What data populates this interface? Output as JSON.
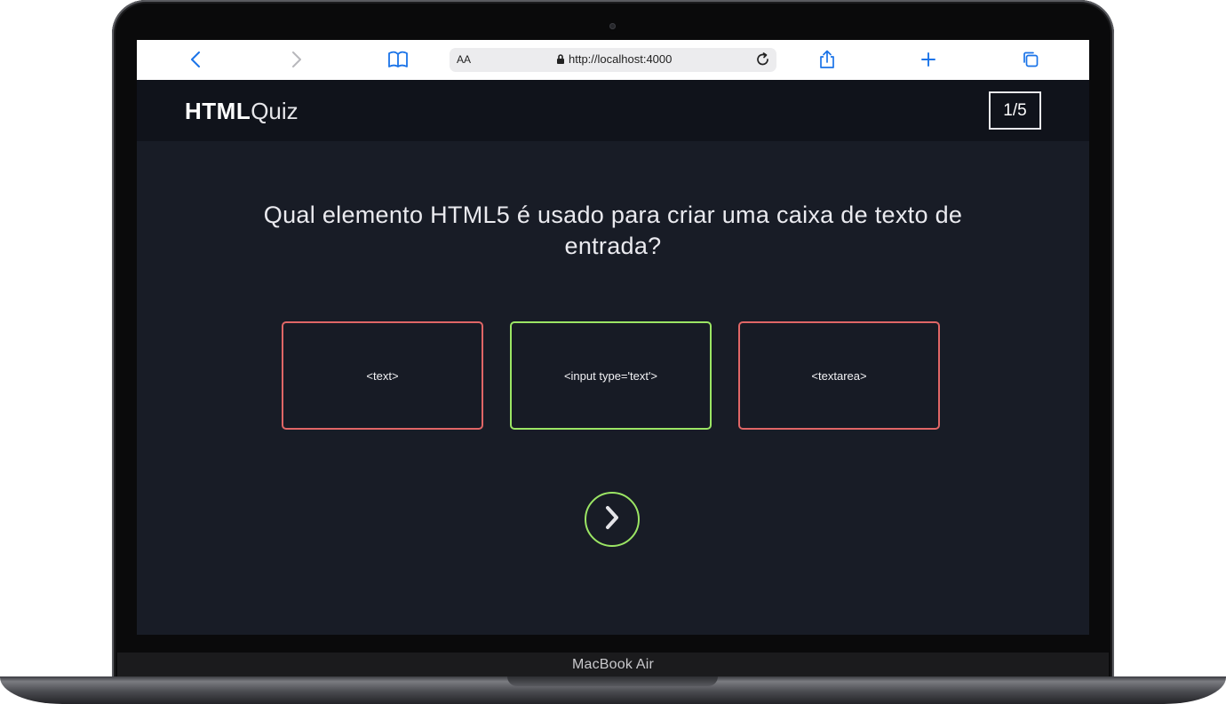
{
  "device": {
    "label": "MacBook Air"
  },
  "browser": {
    "text_size_label": "AA",
    "url": "http://localhost:4000",
    "icons": [
      "back-icon",
      "forward-icon",
      "bookmarks-icon",
      "lock-icon",
      "reload-icon",
      "share-icon",
      "new-tab-icon",
      "tabs-icon"
    ]
  },
  "app": {
    "logo_bold": "HTML",
    "logo_light": "Quiz",
    "progress": "1/5"
  },
  "quiz": {
    "question": "Qual elemento HTML5 é usado para criar uma caixa de texto de entrada?",
    "options": [
      {
        "label": "<text>",
        "state": "incorrect"
      },
      {
        "label": "<input type='text'>",
        "state": "correct"
      },
      {
        "label": "<textarea>",
        "state": "incorrect"
      }
    ],
    "next_icon": "chevron-right-icon"
  },
  "colors": {
    "background": "#181c26",
    "header": "#10131b",
    "correct": "#9be564",
    "incorrect": "#e06666",
    "browser_accent": "#1a73e8"
  }
}
